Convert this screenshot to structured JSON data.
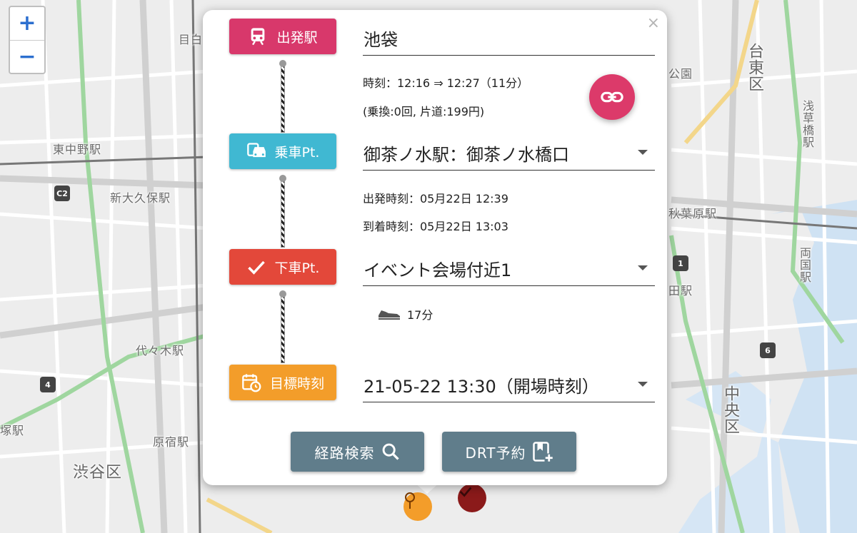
{
  "map": {
    "labels": {
      "meguro": "目白",
      "higashi_nakano": "東中野駅",
      "shin_okubo": "新大久保駅",
      "yoyogi": "代々木駅",
      "sendagaya": "塚駅",
      "harajuku": "原宿駅",
      "shibuya_ku": "渋谷区",
      "taito": "台東区",
      "asakusabashi": "浅草橋駅",
      "akihabara": "秋葉原駅",
      "ryogoku": "両国駅",
      "chuo": "中央区",
      "iidabashi": "田駅",
      "koen": "公園"
    },
    "shields": [
      "C2",
      "4",
      "1",
      "6"
    ]
  },
  "zoom": {
    "in_label": "+",
    "out_label": "−"
  },
  "popup": {
    "close_label": "×",
    "depart": {
      "badge_label": "出発駅",
      "value": "池袋",
      "time": "時刻：12:16 ⇒ 12:27（11分）",
      "fare": "(乗換:0回, 片道:199円)"
    },
    "board": {
      "badge_label": "乗車Pt.",
      "value": "御茶ノ水駅：御茶ノ水橋口",
      "depart_time": "出発時刻：05月22日 12:39",
      "arrive_time": "到着時刻：05月22日 13:03"
    },
    "alight": {
      "badge_label": "下車Pt.",
      "value": "イベント会場付近1",
      "walk_time": "17分"
    },
    "target": {
      "badge_label": "目標時刻",
      "value": "21-05-22 13:30（開場時刻）"
    },
    "buttons": {
      "search_label": "経路検索",
      "drt_label": "DRT予約"
    }
  },
  "colors": {
    "depart": "#d8386b",
    "board": "#40b8d2",
    "alight": "#e3483a",
    "target": "#f39d2a",
    "button": "#607d8b"
  }
}
